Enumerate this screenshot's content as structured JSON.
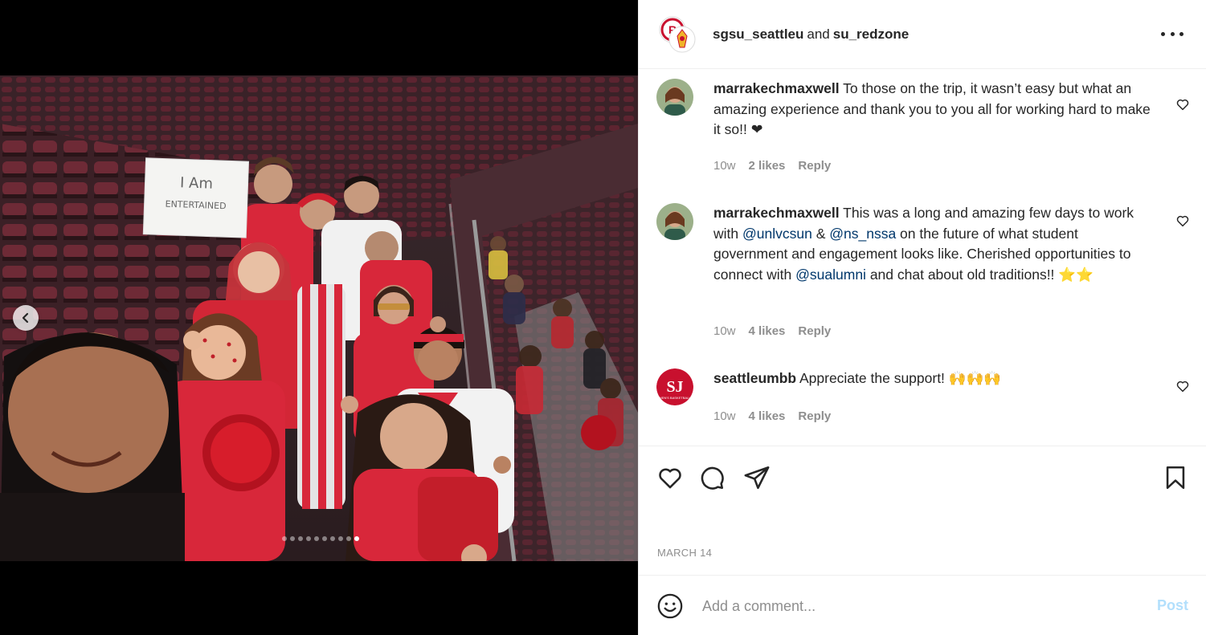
{
  "post": {
    "authors": {
      "primary": "sgsu_seattleu",
      "conjunction": "and",
      "secondary": "su_redzone"
    },
    "photo_sign_text": [
      "I Am",
      "ENTERTAINED"
    ],
    "carousel": {
      "count": 10,
      "active_index": 9
    },
    "date": "MARCH 14"
  },
  "comments": [
    {
      "user": "marrakechmaxwell",
      "text_parts": [
        {
          "t": " To those on the trip, it wasn’t easy but what an amazing experience and thank you to you all for working hard to make it so!! "
        },
        {
          "t": "❤"
        }
      ],
      "age": "10w",
      "likes": "2 likes",
      "reply": "Reply"
    },
    {
      "user": "marrakechmaxwell",
      "text_parts": [
        {
          "t": " This was a long and amazing few days to work with "
        },
        {
          "t": "@unlvcsun",
          "mention": true
        },
        {
          "t": " & "
        },
        {
          "t": "@ns_nssa",
          "mention": true
        },
        {
          "t": " on the future of what student government and engagement looks like. Cherished opportunities to connect with "
        },
        {
          "t": "@sualumni",
          "mention": true
        },
        {
          "t": " and chat about old traditions!! "
        },
        {
          "t": "⭐⭐"
        }
      ],
      "age": "10w",
      "likes": "4 likes",
      "reply": "Reply"
    },
    {
      "user": "seattleumbb",
      "text_parts": [
        {
          "t": " Appreciate the support! "
        },
        {
          "t": "🙌🙌🙌"
        }
      ],
      "age": "10w",
      "likes": "4 likes",
      "reply": "Reply"
    }
  ],
  "add_comment": {
    "placeholder": "Add a comment...",
    "post_label": "Post"
  },
  "colors": {
    "mention": "#00376b",
    "muted": "#8e8e8e",
    "post_disabled": "#b2dffc",
    "brand_red": "#c8102e"
  }
}
